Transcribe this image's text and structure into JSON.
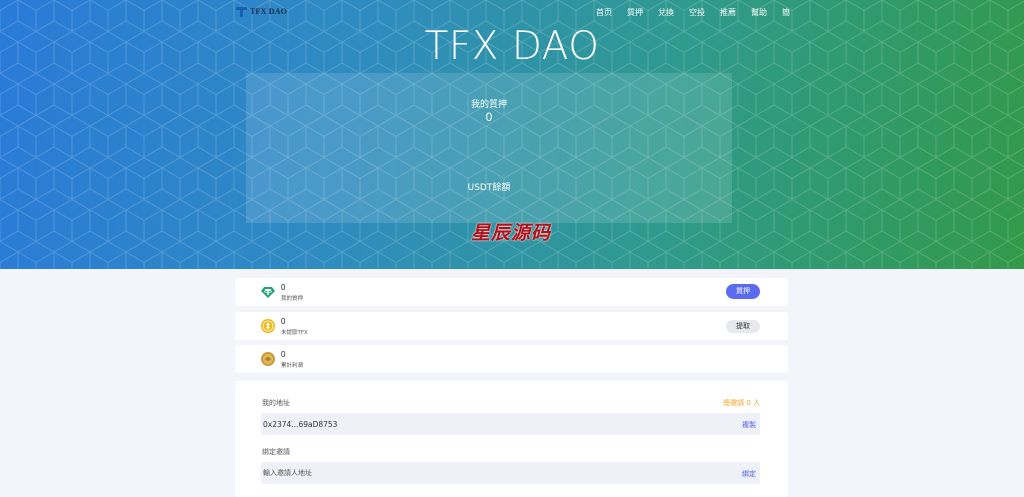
{
  "header": {
    "logo_text": "TFX DAO",
    "nav": [
      "首页",
      "質押",
      "兌換",
      "空投",
      "推薦",
      "幫助",
      "簡"
    ]
  },
  "hero": {
    "title": "TFX DAO",
    "stake_label": "我的質押",
    "stake_value": "0",
    "usdt_label": "USDT餘額",
    "watermark": "星辰源码"
  },
  "cards": [
    {
      "icon": "tether-icon",
      "value": "0",
      "label": "我的質押",
      "button": "質押"
    },
    {
      "icon": "tfx-coin-icon",
      "value": "0",
      "label": "未提取TFX",
      "button": "提取"
    },
    {
      "icon": "gold-coin-icon",
      "value": "0",
      "label": "累計利潤"
    }
  ],
  "address": {
    "label": "我的地址",
    "invite_count": "總邀請 0 人",
    "value": "0x2374...69aD8753",
    "copy_label": "複製"
  },
  "bind": {
    "label": "綁定邀請",
    "placeholder": "輸入邀請人地址",
    "action_label": "綁定"
  },
  "colors": {
    "stake_button": "#5b6bf0",
    "invite_count": "#f0a020",
    "action_link": "#4a5ae8"
  }
}
